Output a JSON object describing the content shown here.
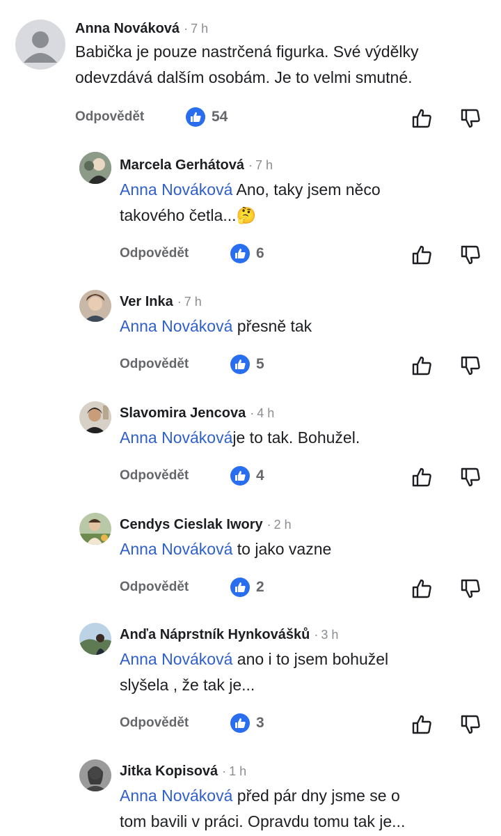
{
  "reply_label": "Odpovědět",
  "comments": [
    {
      "name": "Anna Nováková",
      "dot": "·",
      "time": "7 h",
      "mention": "",
      "text_lines": [
        "Babička je pouze nastrčená figurka. Své výdělky",
        "odevzdává dalším osobám. Je to velmi smutné."
      ],
      "likes": "54",
      "avatar": "default-avatar"
    },
    {
      "name": "Marcela Gerhátová",
      "dot": "·",
      "time": "7 h",
      "mention": "Anna Nováková",
      "text_lines": [
        " Ano, taky jsem něco",
        "takového četla...🤔"
      ],
      "likes": "6",
      "avatar": "profile-photo"
    },
    {
      "name": "Ver Inka",
      "dot": "·",
      "time": "7 h",
      "mention": "Anna Nováková",
      "text_lines": [
        " přesně tak"
      ],
      "likes": "5",
      "avatar": "profile-photo"
    },
    {
      "name": "Slavomira Jencova",
      "dot": "·",
      "time": "4 h",
      "mention": "Anna Nováková",
      "text_lines": [
        "je to tak. Bohužel."
      ],
      "likes": "4",
      "avatar": "profile-photo"
    },
    {
      "name": "Cendys Cieslak Iwory",
      "dot": "·",
      "time": "2 h",
      "mention": "Anna Nováková",
      "text_lines": [
        " to jako vazne"
      ],
      "likes": "2",
      "avatar": "profile-photo"
    },
    {
      "name": "Anďa Náprstník Hynkovášků",
      "dot": "·",
      "time": "3 h",
      "mention": "Anna Nováková",
      "text_lines": [
        " ano i to jsem bohužel",
        "slyšela , že tak je..."
      ],
      "likes": "3",
      "avatar": "profile-photo"
    },
    {
      "name": "Jitka Kopisová",
      "dot": "·",
      "time": "1 h",
      "mention": "Anna Nováková",
      "text_lines": [
        " před pár dny jsme se o",
        "tom bavili v práci. Opravdu tomu tak je..."
      ],
      "likes": "",
      "avatar": "profile-photo"
    }
  ]
}
